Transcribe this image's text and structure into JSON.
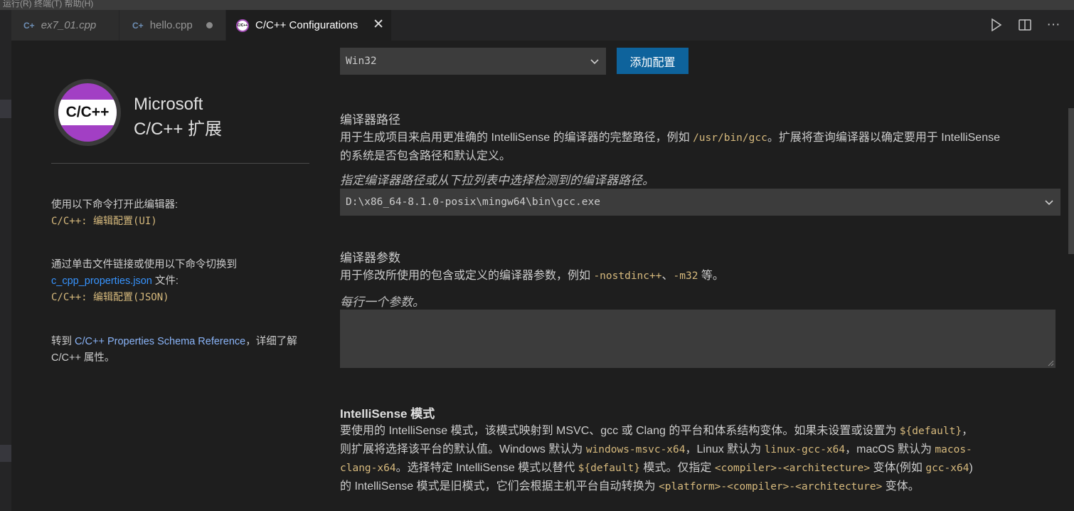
{
  "menubar": {
    "text": "运行(R)   终端(T)   帮助(H)"
  },
  "tabs": [
    {
      "label": "ex7_01.cpp",
      "icon": "cpp-file-icon",
      "italic": true
    },
    {
      "label": "hello.cpp",
      "icon": "cpp-file-icon",
      "dirty": true
    },
    {
      "label": "C/C++ Configurations",
      "icon": "cpp-extension-icon",
      "active": true
    }
  ],
  "tab_actions": {
    "run": "▷",
    "split": "split-editor-icon",
    "more": "···"
  },
  "sidebar": {
    "logo_text": "C/C++",
    "brand_line1": "Microsoft",
    "brand_line2": "C/C++ 扩展",
    "open_editor_intro": "使用以下命令打开此编辑器:",
    "open_editor_cmd": "C/C++: 编辑配置(UI)",
    "switch_intro": "通过单击文件链接或使用以下命令切换到",
    "switch_file_link": "c_cpp_properties.json",
    "switch_file_suffix": " 文件:",
    "switch_cmd": "C/C++: 编辑配置(JSON)",
    "schema_prefix": "转到 ",
    "schema_link": "C/C++ Properties Schema Reference",
    "schema_suffix": "，详细了解 C/C++ 属性。"
  },
  "config": {
    "selected": "Win32",
    "add_button": "添加配置"
  },
  "compiler_path": {
    "title": "编译器路径",
    "desc_part1": "用于生成项目来启用更准确的 IntelliSense 的编译器的完整路径，例如 ",
    "desc_code": "/usr/bin/gcc",
    "desc_part2": "。扩展将查询编译器以确定要用于 IntelliSense 的系统是否包含路径和默认定义。",
    "hint": "指定编译器路径或从下拉列表中选择检测到的编译器路径。",
    "value": "D:\\x86_64-8.1.0-posix\\mingw64\\bin\\gcc.exe"
  },
  "compiler_args": {
    "title": "编译器参数",
    "desc_part1": "用于修改所使用的包含或定义的编译器参数，例如 ",
    "desc_code1": "-nostdinc++",
    "desc_sep": "、",
    "desc_code2": "-m32",
    "desc_part2": " 等。",
    "hint": "每行一个参数。",
    "value": ""
  },
  "intellisense_mode": {
    "title": "IntelliSense 模式",
    "t1": "要使用的 IntelliSense 模式，该模式映射到 MSVC、gcc 或 Clang 的平台和体系结构变体。如果未设置或设置为 ",
    "c1": "${default}",
    "t2": "，则扩展将选择该平台的默认值。Windows 默认为 ",
    "c2": "windows-msvc-x64",
    "t3": "，Linux 默认为 ",
    "c3": "linux-gcc-x64",
    "t4": "，macOS 默认为 ",
    "c4": "macos-clang-x64",
    "t5": "。选择特定 IntelliSense 模式以替代 ",
    "c5": "${default}",
    "t6": " 模式。仅指定 ",
    "c6": "<compiler>-<architecture>",
    "t7": " 变体(例如 ",
    "c7": "gcc-x64",
    "t8": ")的 IntelliSense 模式是旧模式，它们会根据主机平台自动转换为 ",
    "c8": "<platform>-<compiler>-<architecture>",
    "t9": " 变体。"
  }
}
